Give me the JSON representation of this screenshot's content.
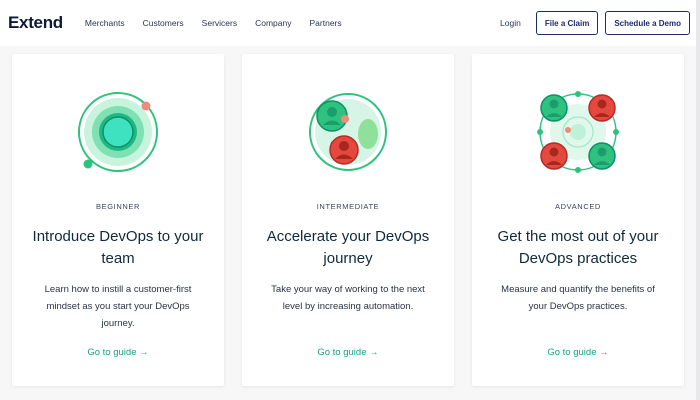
{
  "nav": {
    "logo": "Extend",
    "links": [
      "Merchants",
      "Customers",
      "Servicers",
      "Company",
      "Partners"
    ],
    "login": "Login",
    "file_claim": "File a Claim",
    "schedule_demo": "Schedule a Demo"
  },
  "cards": [
    {
      "level": "BEGINNER",
      "title": "Introduce DevOps to your team",
      "description": "Learn how to instill a customer-first mindset as you start your DevOps journey.",
      "link": "Go to guide →"
    },
    {
      "level": "INTERMEDIATE",
      "title": "Accelerate your DevOps journey",
      "description": "Take your way of working to the next level by increasing automation.",
      "link": "Go to guide →"
    },
    {
      "level": "ADVANCED",
      "title": "Get the most out of your DevOps practices",
      "description": "Measure and quantify the benefits of your DevOps practices.",
      "link": "Go to guide →"
    }
  ],
  "colors": {
    "accent_green": "#2ec27e",
    "teal": "#16a085",
    "red": "#e5483e",
    "navy": "#1c2b6e"
  }
}
